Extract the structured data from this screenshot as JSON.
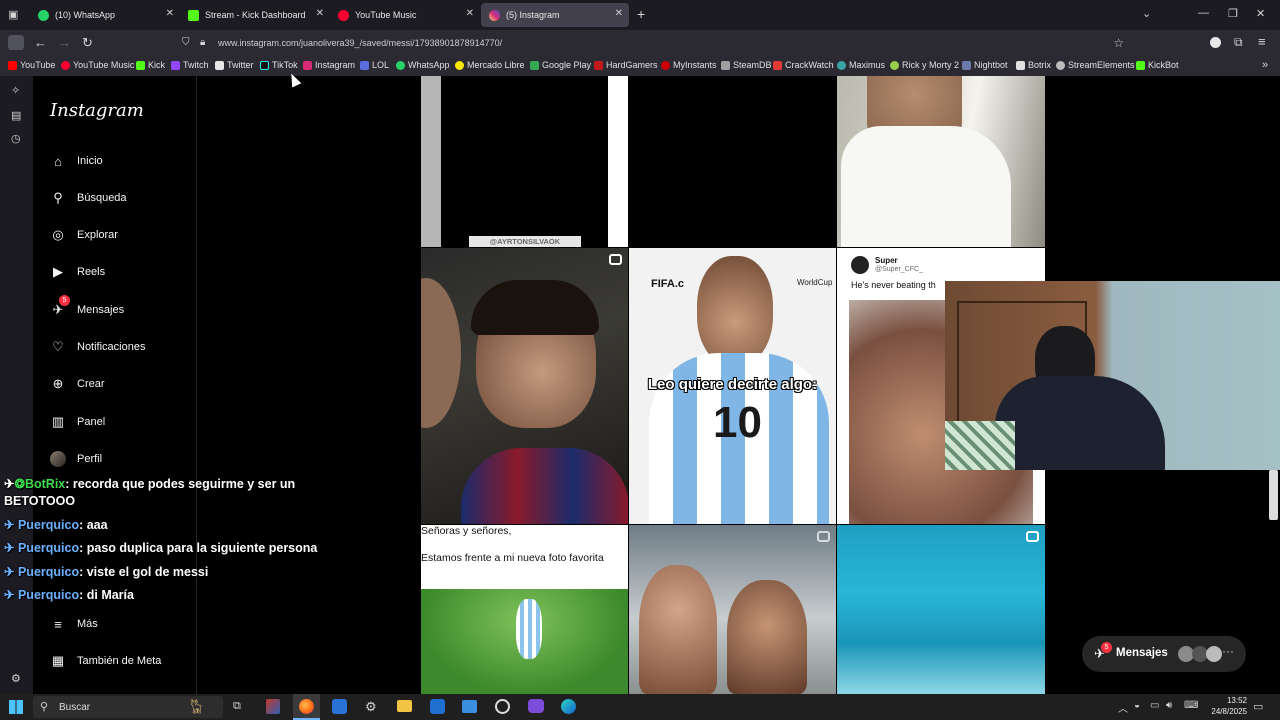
{
  "tabs": [
    {
      "label": "(10) WhatsApp",
      "color": "#25d366"
    },
    {
      "label": "Stream - Kick Dashboard",
      "color": "#53fc18"
    },
    {
      "label": "YouTube Music",
      "color": "#ff0033"
    },
    {
      "label": "(5) Instagram",
      "color": "#e1306c"
    }
  ],
  "address": {
    "url": "www.instagram.com/juanolivera39_/saved/messi/17938901878914770/"
  },
  "bookmarks": [
    "YouTube",
    "YouTube Music",
    "Kick",
    "Twitch",
    "Twitter",
    "TikTok",
    "Instagram",
    "LOL",
    "WhatsApp",
    "Mercado Libre",
    "Google Play",
    "HardGamers",
    "MyInstants",
    "SteamDB",
    "CrackWatch",
    "Maximus",
    "Rick y Morty 2",
    "Nightbot",
    "Botrix",
    "StreamElements",
    "KickBot"
  ],
  "instagram": {
    "logo": "Instagram",
    "nav": [
      "Inicio",
      "Búsqueda",
      "Explorar",
      "Reels",
      "Mensajes",
      "Notificaciones",
      "Crear",
      "Panel",
      "Perfil",
      "Más",
      "También de Meta"
    ],
    "messages_badge": "5",
    "messages_button": "Mensajes",
    "messages_button_badge": "5"
  },
  "posts": {
    "watermark": "@AYRTONSILVAOK",
    "leo_caption": "Leo quiere decirte algo:",
    "fifa_text": "FIFA.c",
    "worldcup_text": "WorldCup",
    "jersey_number": "10",
    "tweet_name": "Super",
    "tweet_handle": "@Super_CFC_",
    "tweet_text": "He's never beating th",
    "caption_line1": "Señoras y señores,",
    "caption_line2": "Estamos frente a mi nueva foto favorita"
  },
  "chat": [
    {
      "user": "BotRix",
      "text": "recorda que podes seguirme y ser un BETOTOOO"
    },
    {
      "user": "Puerquico",
      "text": "aaa"
    },
    {
      "user": "Puerquico",
      "text": "paso duplica para la siguiente persona"
    },
    {
      "user": "Puerquico",
      "text": "viste el gol de messi"
    },
    {
      "user": "Puerquico",
      "text": "di María"
    }
  ],
  "taskbar": {
    "search_placeholder": "Buscar",
    "time": "13:52",
    "date": "24/8/2025"
  }
}
